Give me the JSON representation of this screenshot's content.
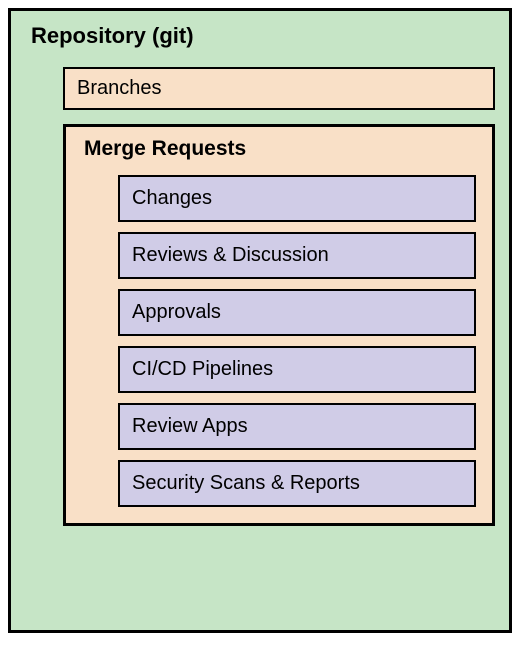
{
  "repository": {
    "title": "Repository (git)",
    "branches_label": "Branches",
    "merge_requests": {
      "title": "Merge Requests",
      "items": [
        "Changes",
        "Reviews & Discussion",
        "Approvals",
        "CI/CD Pipelines",
        "Review Apps",
        "Security Scans & Reports"
      ]
    }
  }
}
